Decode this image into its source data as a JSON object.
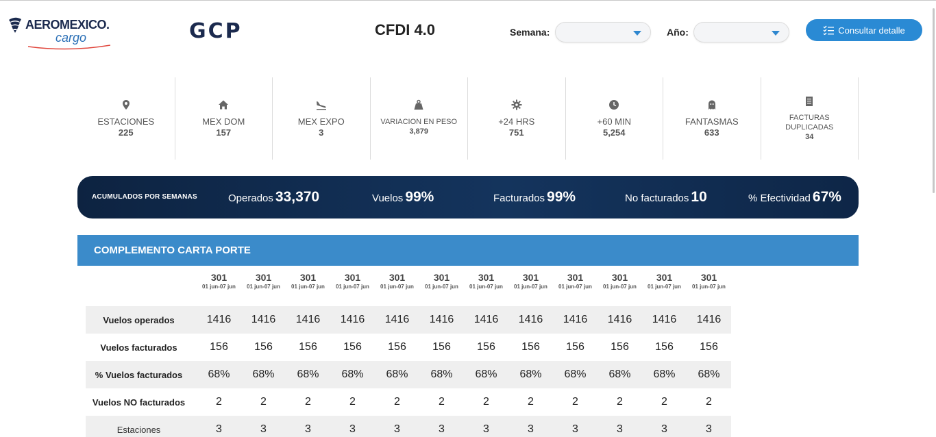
{
  "header": {
    "brand": "AEROMEXICO.",
    "brand_sub": "cargo",
    "app_name": "GCP",
    "title": "CFDI 4.0",
    "semana_label": "Semana:",
    "semana_value": "",
    "anio_label": "Año:",
    "anio_value": "",
    "consultar_label": "Consultar detalle"
  },
  "kpis": [
    {
      "icon": "location-pin-icon",
      "label": "ESTACIONES",
      "value": "225"
    },
    {
      "icon": "home-icon",
      "label": "MEX DOM",
      "value": "157"
    },
    {
      "icon": "plane-landing-icon",
      "label": "MEX EXPO",
      "value": "3"
    },
    {
      "icon": "weight-icon",
      "label": "VARIACION EN PESO",
      "value": "3,879"
    },
    {
      "icon": "gear-icon",
      "label": "+24 HRS",
      "value": "751"
    },
    {
      "icon": "clock-icon",
      "label": "+60 MIN",
      "value": "5,254"
    },
    {
      "icon": "ghost-icon",
      "label": "FANTASMAS",
      "value": "633"
    },
    {
      "icon": "receipt-icon",
      "label_line1": "FACTURAS",
      "label_line2": "DUPLICADAS",
      "value": "34"
    }
  ],
  "accumulated": {
    "title": "ACUMULADOS POR SEMANAS",
    "operados_label": "Operados",
    "operados_value": "33,370",
    "vuelos_label": "Vuelos",
    "vuelos_value": "99%",
    "facturados_label": "Facturados",
    "facturados_value": "99%",
    "no_facturados_label": "No facturados",
    "no_facturados_value": "10",
    "efectividad_label": "% Efectividad",
    "efectividad_value": "67%"
  },
  "section": {
    "title": "COMPLEMENTO CARTA PORTE"
  },
  "table": {
    "columns": [
      {
        "week": "301",
        "range": "01 jun-07 jun"
      },
      {
        "week": "301",
        "range": "01 jun-07 jun"
      },
      {
        "week": "301",
        "range": "01 jun-07 jun"
      },
      {
        "week": "301",
        "range": "01 jun-07 jun"
      },
      {
        "week": "301",
        "range": "01 jun-07 jun"
      },
      {
        "week": "301",
        "range": "01 jun-07 jun"
      },
      {
        "week": "301",
        "range": "01 jun-07 jun"
      },
      {
        "week": "301",
        "range": "01 jun-07 jun"
      },
      {
        "week": "301",
        "range": "01 jun-07 jun"
      },
      {
        "week": "301",
        "range": "01 jun-07 jun"
      },
      {
        "week": "301",
        "range": "01 jun-07 jun"
      },
      {
        "week": "301",
        "range": "01 jun-07 jun"
      }
    ],
    "rows": [
      {
        "label": "Vuelos operados",
        "values": [
          "1416",
          "1416",
          "1416",
          "1416",
          "1416",
          "1416",
          "1416",
          "1416",
          "1416",
          "1416",
          "1416",
          "1416"
        ]
      },
      {
        "label": "Vuelos facturados",
        "values": [
          "156",
          "156",
          "156",
          "156",
          "156",
          "156",
          "156",
          "156",
          "156",
          "156",
          "156",
          "156"
        ]
      },
      {
        "label": "% Vuelos facturados",
        "values": [
          "68%",
          "68%",
          "68%",
          "68%",
          "68%",
          "68%",
          "68%",
          "68%",
          "68%",
          "68%",
          "68%",
          "68%"
        ]
      },
      {
        "label": "Vuelos NO facturados",
        "values": [
          "2",
          "2",
          "2",
          "2",
          "2",
          "2",
          "2",
          "2",
          "2",
          "2",
          "2",
          "2"
        ]
      },
      {
        "label": "Estaciones",
        "values": [
          "3",
          "3",
          "3",
          "3",
          "3",
          "3",
          "3",
          "3",
          "3",
          "3",
          "3",
          "3"
        ]
      }
    ]
  },
  "colors": {
    "primary_blue": "#2a8ad4",
    "section_blue": "#3b8bca",
    "banner_navy": "#0d2341"
  }
}
